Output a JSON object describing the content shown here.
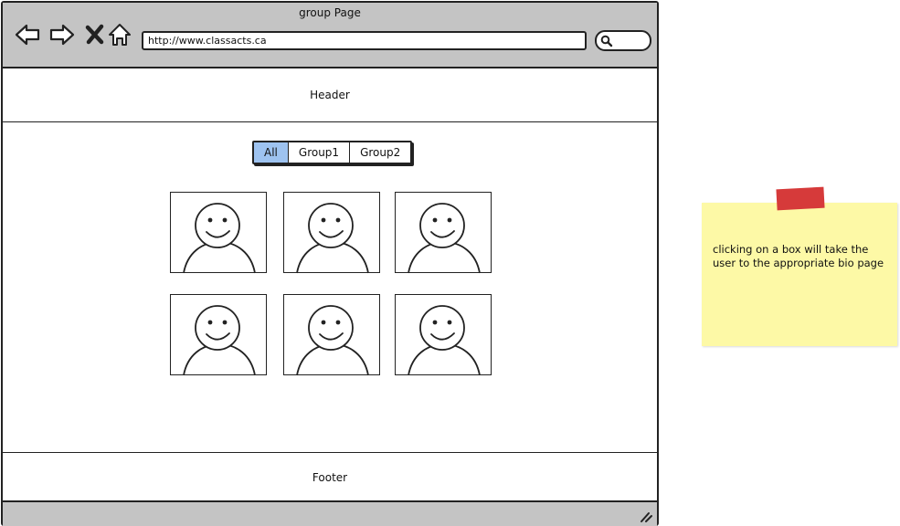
{
  "window": {
    "title": "group Page",
    "url": "http://www.classacts.ca",
    "nav_icons": [
      "back-arrow-icon",
      "forward-arrow-icon",
      "close-x-icon",
      "home-icon"
    ],
    "search_icon": "search-icon"
  },
  "header": {
    "label": "Header"
  },
  "tabs": [
    {
      "label": "All",
      "selected": true
    },
    {
      "label": "Group1",
      "selected": false
    },
    {
      "label": "Group2",
      "selected": false
    }
  ],
  "profiles": {
    "icon": "person-placeholder-icon",
    "count": 6
  },
  "footer": {
    "label": "Footer"
  },
  "sticky_note": {
    "text": "clicking on a box will take the user to the appropriate bio page",
    "color": "#fdf9a6",
    "tape_color": "#d63a3a"
  },
  "colors": {
    "chrome": "#c4c4c4",
    "selected_tab": "#9ec3f0"
  }
}
